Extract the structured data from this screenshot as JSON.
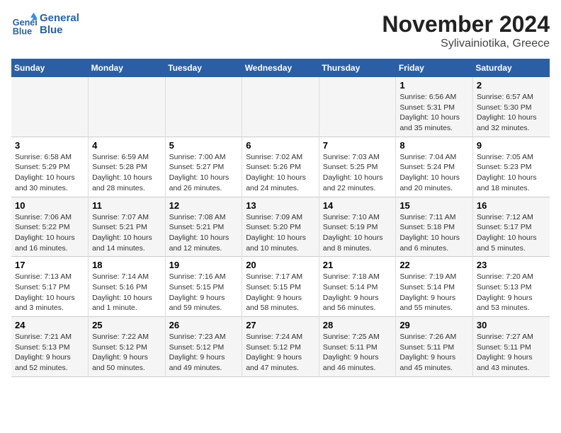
{
  "header": {
    "logo_line1": "General",
    "logo_line2": "Blue",
    "month_title": "November 2024",
    "location": "Sylivainiotika, Greece"
  },
  "days_of_week": [
    "Sunday",
    "Monday",
    "Tuesday",
    "Wednesday",
    "Thursday",
    "Friday",
    "Saturday"
  ],
  "weeks": [
    [
      {
        "day": "",
        "info": ""
      },
      {
        "day": "",
        "info": ""
      },
      {
        "day": "",
        "info": ""
      },
      {
        "day": "",
        "info": ""
      },
      {
        "day": "",
        "info": ""
      },
      {
        "day": "1",
        "info": "Sunrise: 6:56 AM\nSunset: 5:31 PM\nDaylight: 10 hours and 35 minutes."
      },
      {
        "day": "2",
        "info": "Sunrise: 6:57 AM\nSunset: 5:30 PM\nDaylight: 10 hours and 32 minutes."
      }
    ],
    [
      {
        "day": "3",
        "info": "Sunrise: 6:58 AM\nSunset: 5:29 PM\nDaylight: 10 hours and 30 minutes."
      },
      {
        "day": "4",
        "info": "Sunrise: 6:59 AM\nSunset: 5:28 PM\nDaylight: 10 hours and 28 minutes."
      },
      {
        "day": "5",
        "info": "Sunrise: 7:00 AM\nSunset: 5:27 PM\nDaylight: 10 hours and 26 minutes."
      },
      {
        "day": "6",
        "info": "Sunrise: 7:02 AM\nSunset: 5:26 PM\nDaylight: 10 hours and 24 minutes."
      },
      {
        "day": "7",
        "info": "Sunrise: 7:03 AM\nSunset: 5:25 PM\nDaylight: 10 hours and 22 minutes."
      },
      {
        "day": "8",
        "info": "Sunrise: 7:04 AM\nSunset: 5:24 PM\nDaylight: 10 hours and 20 minutes."
      },
      {
        "day": "9",
        "info": "Sunrise: 7:05 AM\nSunset: 5:23 PM\nDaylight: 10 hours and 18 minutes."
      }
    ],
    [
      {
        "day": "10",
        "info": "Sunrise: 7:06 AM\nSunset: 5:22 PM\nDaylight: 10 hours and 16 minutes."
      },
      {
        "day": "11",
        "info": "Sunrise: 7:07 AM\nSunset: 5:21 PM\nDaylight: 10 hours and 14 minutes."
      },
      {
        "day": "12",
        "info": "Sunrise: 7:08 AM\nSunset: 5:21 PM\nDaylight: 10 hours and 12 minutes."
      },
      {
        "day": "13",
        "info": "Sunrise: 7:09 AM\nSunset: 5:20 PM\nDaylight: 10 hours and 10 minutes."
      },
      {
        "day": "14",
        "info": "Sunrise: 7:10 AM\nSunset: 5:19 PM\nDaylight: 10 hours and 8 minutes."
      },
      {
        "day": "15",
        "info": "Sunrise: 7:11 AM\nSunset: 5:18 PM\nDaylight: 10 hours and 6 minutes."
      },
      {
        "day": "16",
        "info": "Sunrise: 7:12 AM\nSunset: 5:17 PM\nDaylight: 10 hours and 5 minutes."
      }
    ],
    [
      {
        "day": "17",
        "info": "Sunrise: 7:13 AM\nSunset: 5:17 PM\nDaylight: 10 hours and 3 minutes."
      },
      {
        "day": "18",
        "info": "Sunrise: 7:14 AM\nSunset: 5:16 PM\nDaylight: 10 hours and 1 minute."
      },
      {
        "day": "19",
        "info": "Sunrise: 7:16 AM\nSunset: 5:15 PM\nDaylight: 9 hours and 59 minutes."
      },
      {
        "day": "20",
        "info": "Sunrise: 7:17 AM\nSunset: 5:15 PM\nDaylight: 9 hours and 58 minutes."
      },
      {
        "day": "21",
        "info": "Sunrise: 7:18 AM\nSunset: 5:14 PM\nDaylight: 9 hours and 56 minutes."
      },
      {
        "day": "22",
        "info": "Sunrise: 7:19 AM\nSunset: 5:14 PM\nDaylight: 9 hours and 55 minutes."
      },
      {
        "day": "23",
        "info": "Sunrise: 7:20 AM\nSunset: 5:13 PM\nDaylight: 9 hours and 53 minutes."
      }
    ],
    [
      {
        "day": "24",
        "info": "Sunrise: 7:21 AM\nSunset: 5:13 PM\nDaylight: 9 hours and 52 minutes."
      },
      {
        "day": "25",
        "info": "Sunrise: 7:22 AM\nSunset: 5:12 PM\nDaylight: 9 hours and 50 minutes."
      },
      {
        "day": "26",
        "info": "Sunrise: 7:23 AM\nSunset: 5:12 PM\nDaylight: 9 hours and 49 minutes."
      },
      {
        "day": "27",
        "info": "Sunrise: 7:24 AM\nSunset: 5:12 PM\nDaylight: 9 hours and 47 minutes."
      },
      {
        "day": "28",
        "info": "Sunrise: 7:25 AM\nSunset: 5:11 PM\nDaylight: 9 hours and 46 minutes."
      },
      {
        "day": "29",
        "info": "Sunrise: 7:26 AM\nSunset: 5:11 PM\nDaylight: 9 hours and 45 minutes."
      },
      {
        "day": "30",
        "info": "Sunrise: 7:27 AM\nSunset: 5:11 PM\nDaylight: 9 hours and 43 minutes."
      }
    ]
  ]
}
